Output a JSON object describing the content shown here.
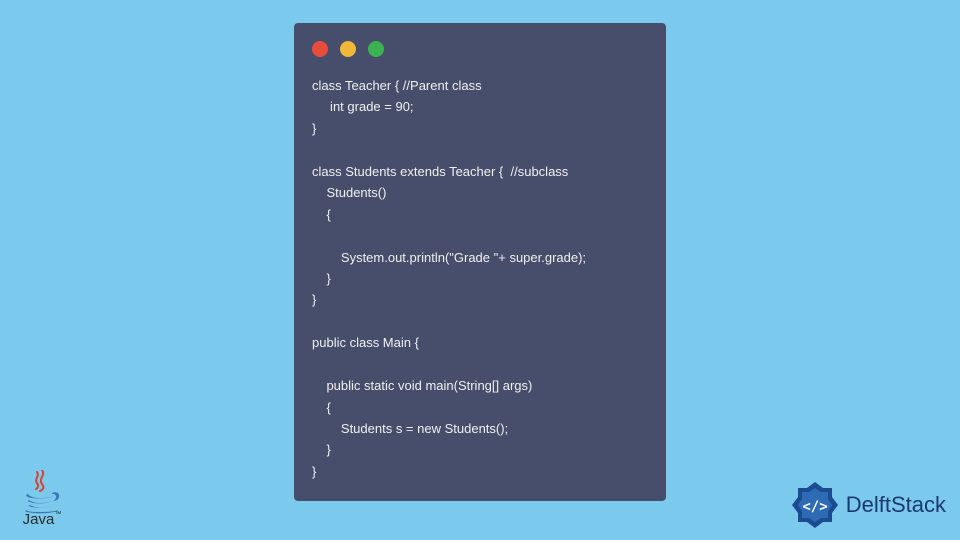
{
  "window": {
    "background": "#474e6c"
  },
  "code": {
    "lines": [
      "class Teacher { //Parent class",
      "     int grade = 90;",
      "}",
      "",
      "class Students extends Teacher {  //subclass",
      "    Students()",
      "    {",
      "    ",
      "        System.out.println(\"Grade \"+ super.grade);",
      "    }",
      "}",
      "",
      "public class Main {",
      "  ",
      "    public static void main(String[] args)",
      "    {",
      "        Students s = new Students();",
      "    }",
      "}"
    ]
  },
  "badges": {
    "java_label": "Java",
    "java_tm": "™",
    "brand_name": "DelftStack"
  },
  "colors": {
    "page_bg": "#7bc9ed",
    "code_bg": "#474e6c",
    "red": "#e94b3c",
    "yellow": "#f0b838",
    "green": "#3bb251",
    "brand_blue": "#1b3a6b"
  }
}
